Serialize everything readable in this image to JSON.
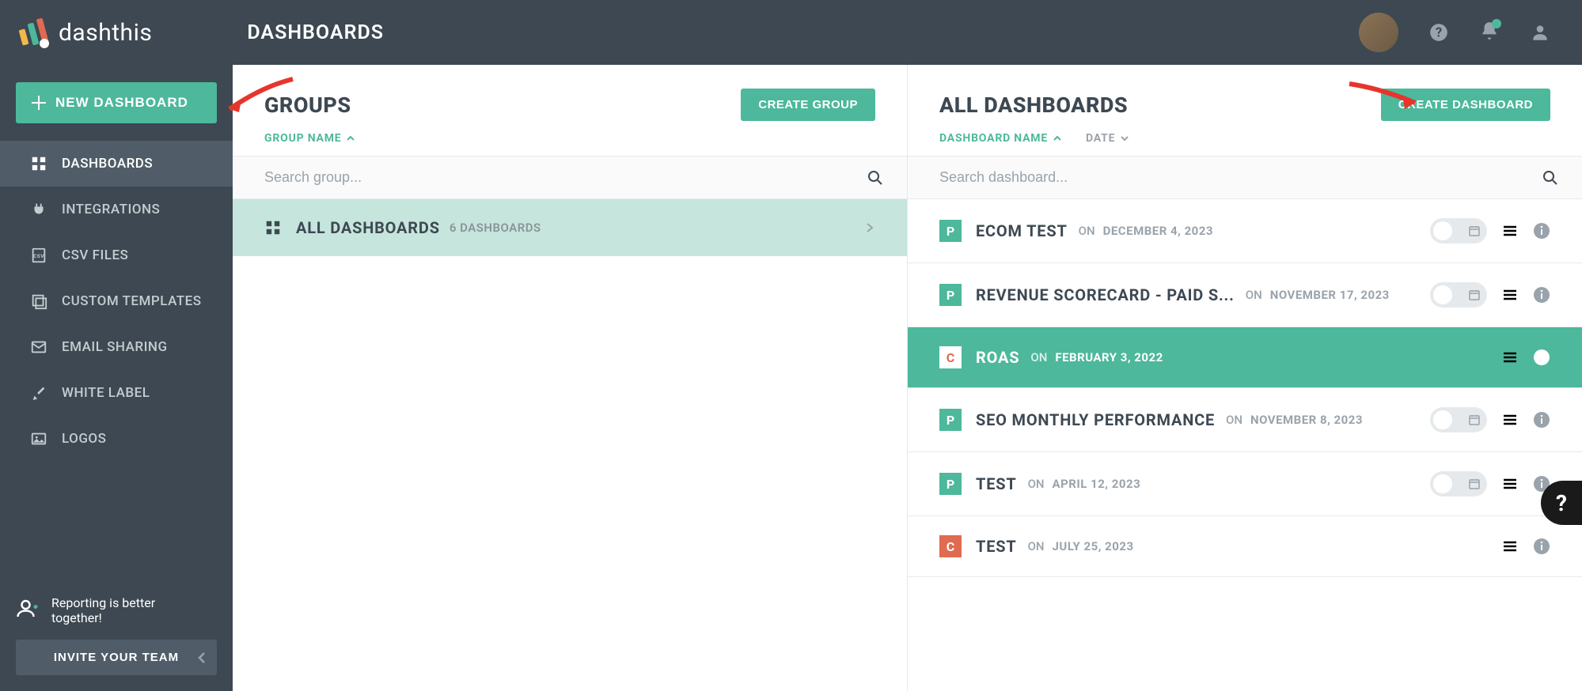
{
  "brand": "dashthis",
  "page_title": "DASHBOARDS",
  "sidebar": {
    "new_dashboard": "NEW DASHBOARD",
    "items": [
      {
        "label": "DASHBOARDS",
        "icon": "dashboard"
      },
      {
        "label": "INTEGRATIONS",
        "icon": "plug"
      },
      {
        "label": "CSV FILES",
        "icon": "csv"
      },
      {
        "label": "CUSTOM TEMPLATES",
        "icon": "templates"
      },
      {
        "label": "EMAIL SHARING",
        "icon": "mail"
      },
      {
        "label": "WHITE LABEL",
        "icon": "brush"
      },
      {
        "label": "LOGOS",
        "icon": "image"
      }
    ],
    "promo_line1": "Reporting is better",
    "promo_line2": "together!",
    "invite": "INVITE YOUR TEAM"
  },
  "groups": {
    "title": "GROUPS",
    "create": "CREATE GROUP",
    "sort_label": "GROUP NAME",
    "search_placeholder": "Search group...",
    "all_name": "ALL DASHBOARDS",
    "all_count": "6 DASHBOARDS"
  },
  "dashboards": {
    "title": "ALL DASHBOARDS",
    "create": "CREATE DASHBOARD",
    "sort_name": "DASHBOARD NAME",
    "sort_date": "DATE",
    "search_placeholder": "Search dashboard...",
    "on": "ON",
    "items": [
      {
        "badge": "P",
        "name": "ECOM TEST",
        "date": "DECEMBER 4, 2023",
        "toggle": true
      },
      {
        "badge": "P",
        "name": "REVENUE SCORECARD - PAID S...",
        "date": "NOVEMBER 17, 2023",
        "toggle": true
      },
      {
        "badge": "C",
        "name": "ROAS",
        "date": "FEBRUARY 3, 2022",
        "toggle": false,
        "active": true
      },
      {
        "badge": "P",
        "name": "SEO MONTHLY PERFORMANCE",
        "date": "NOVEMBER 8, 2023",
        "toggle": true
      },
      {
        "badge": "P",
        "name": "TEST",
        "date": "APRIL 12, 2023",
        "toggle": true
      },
      {
        "badge": "C",
        "name": "TEST",
        "date": "JULY 25, 2023",
        "toggle": false
      }
    ]
  },
  "help": "?"
}
